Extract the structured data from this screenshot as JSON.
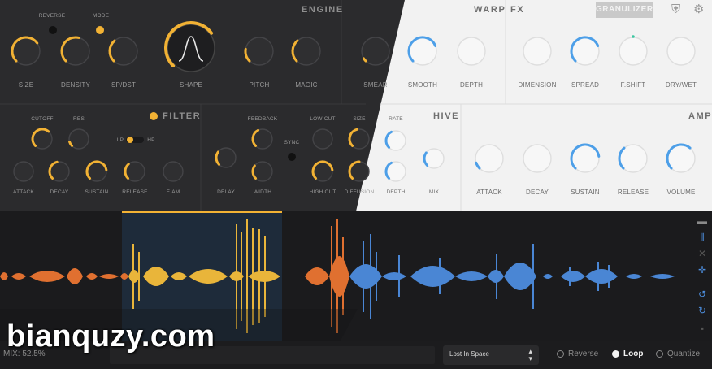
{
  "engine": {
    "title": "ENGINE",
    "knobs": [
      {
        "label": "SIZE",
        "value": 0.7
      },
      {
        "label": "DENSITY",
        "value": 0.55
      },
      {
        "label": "SP/DST",
        "value": 0.35
      },
      {
        "label": "SHAPE",
        "value": 0.7
      },
      {
        "label": "PITCH",
        "value": 0.2
      },
      {
        "label": "MAGIC",
        "value": 0.35
      }
    ],
    "toggles": [
      {
        "label": "REVERSE",
        "on": false
      },
      {
        "label": "MODE",
        "on": true
      }
    ]
  },
  "warp": {
    "title": "WARP",
    "knobs": [
      {
        "label": "SMEAR",
        "value": 0.05
      },
      {
        "label": "SMOOTH",
        "value": 0.75
      },
      {
        "label": "DEPTH",
        "value": 0.0
      }
    ]
  },
  "fx": {
    "title": "FX",
    "mode_button": "GRANULIZER",
    "knobs": [
      {
        "label": "DIMENSION",
        "value": 0.0
      },
      {
        "label": "SPREAD",
        "value": 0.75
      },
      {
        "label": "F.SHIFT",
        "value": 0.5
      },
      {
        "label": "DRY/WET",
        "value": 0.0
      }
    ]
  },
  "filter": {
    "title": "FILTER",
    "enabled": true,
    "knobs": [
      {
        "label": "CUTOFF",
        "value": 0.65
      },
      {
        "label": "RES",
        "value": 0.1
      },
      {
        "label": "ATTACK",
        "value": 0.0
      },
      {
        "label": "DECAY",
        "value": 0.45
      },
      {
        "label": "SUSTAIN",
        "value": 0.8
      },
      {
        "label": "RELEASE",
        "value": 0.35
      },
      {
        "label": "E.AM",
        "value": 0.0
      }
    ],
    "type_labels": [
      "LP",
      "HP"
    ]
  },
  "delay": {
    "knobs": [
      {
        "label": "FEEDBACK",
        "value": 0.4
      },
      {
        "label": "LOW CUT",
        "value": 0.0
      },
      {
        "label": "SIZE",
        "value": 0.45
      },
      {
        "label": "DELAY",
        "value": 0.3
      },
      {
        "label": "WIDTH",
        "value": 0.3
      },
      {
        "label": "HIGH CUT",
        "value": 0.8
      },
      {
        "label": "DIFFUSION",
        "value": 0.5
      }
    ],
    "sync_label": "SYNC"
  },
  "hive": {
    "title": "HIVE",
    "knobs": [
      {
        "label": "RATE",
        "value": 0.4
      },
      {
        "label": "DEPTH",
        "value": 0.4
      },
      {
        "label": "MIX",
        "value": 0.3
      }
    ]
  },
  "amp": {
    "title": "AMP",
    "knobs": [
      {
        "label": "ATTACK",
        "value": 0.1
      },
      {
        "label": "DECAY",
        "value": 0.0
      },
      {
        "label": "SUSTAIN",
        "value": 0.8
      },
      {
        "label": "RELEASE",
        "value": 0.35
      },
      {
        "label": "VOLUME",
        "value": 0.65
      }
    ]
  },
  "footer": {
    "mix": "MIX: 52.5%",
    "preset": "Lost In Space",
    "options": [
      {
        "label": "Reverse",
        "selected": false
      },
      {
        "label": "Loop",
        "selected": true
      },
      {
        "label": "Quantize",
        "selected": false
      }
    ]
  },
  "colors": {
    "accent_dark": "#f2b234",
    "accent_light": "#4d9fe8",
    "waveform_orange": "#e07030",
    "waveform_yellow": "#e9b53a",
    "waveform_blue": "#4a86d4"
  },
  "watermark": "bianquzy.com"
}
